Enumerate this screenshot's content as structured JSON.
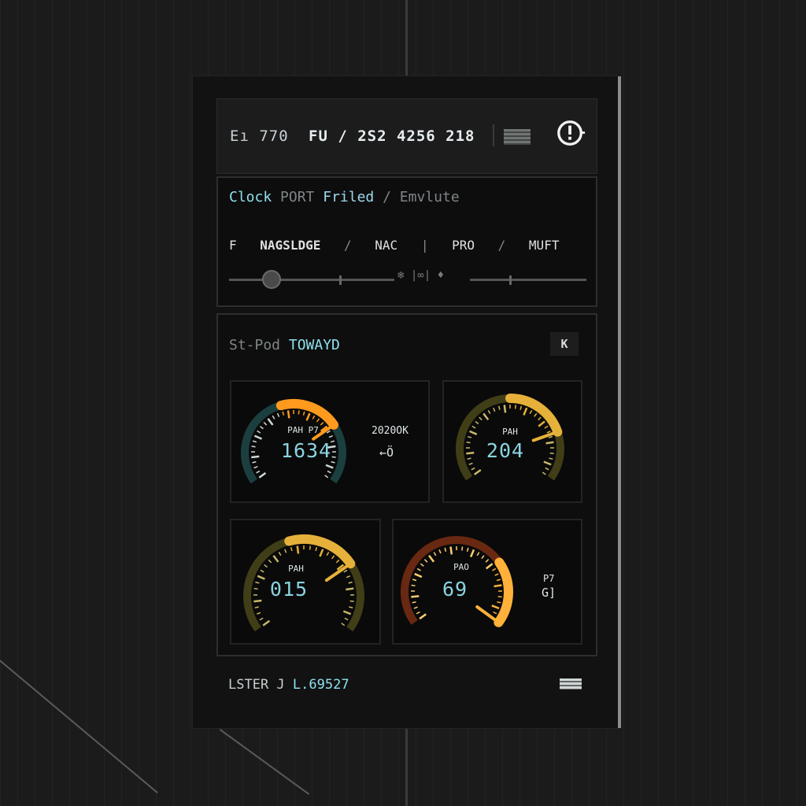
{
  "header": {
    "code": "Eı 770",
    "id": "FU / 2S2 4256 218"
  },
  "mode_panel": {
    "breadcrumb": [
      "Clock",
      "PORT",
      "Friled",
      "/",
      "Emvlute"
    ],
    "tabs": [
      "F",
      "NAGSLDGE",
      "/",
      "NAC",
      "|",
      "PRO",
      "/",
      "MUFT"
    ],
    "slider_mid_text": "❄ |∞| ♦"
  },
  "gauge_panel": {
    "title_prefix": "St-Pod",
    "title_main": "TOWAYD",
    "badge": "K",
    "gauges": [
      {
        "label": "PAH P7",
        "value": "1634",
        "fraction": 0.72,
        "theme": "cyan-orange"
      },
      {
        "label": "PAH",
        "value": "204",
        "fraction": 0.78,
        "theme": "olive"
      },
      {
        "label": "PAH",
        "value": "015",
        "fraction": 0.72,
        "theme": "olive"
      },
      {
        "label": "PAO",
        "value": "69",
        "fraction": 1.0,
        "theme": "orange"
      }
    ],
    "side_top": "2020OK",
    "side_top_sub": "←Ö",
    "side_bottom": "P7",
    "side_bottom_sub": "G]"
  },
  "footer": {
    "label_prefix": "LSTER J",
    "label_value": "L.69527"
  },
  "colors": {
    "accent_cyan": "#8fe0ef",
    "accent_orange": "#ff8a1a",
    "accent_amber": "#e6b13a"
  }
}
